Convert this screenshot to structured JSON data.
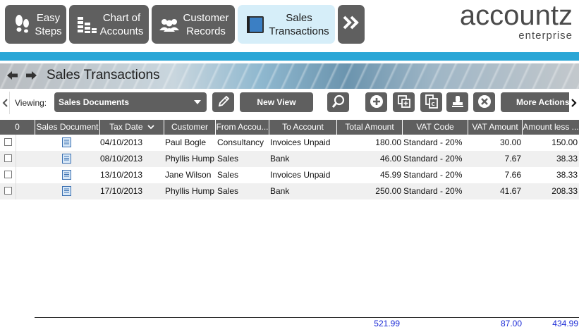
{
  "nav": {
    "items": [
      {
        "label_line1": "Easy",
        "label_line2": "Steps",
        "icon": "footprints-icon"
      },
      {
        "label_line1": "Chart of",
        "label_line2": "Accounts",
        "icon": "coins-chart-icon"
      },
      {
        "label_line1": "Customer",
        "label_line2": "Records",
        "icon": "people-icon"
      },
      {
        "label_line1": "Sales",
        "label_line2": "Transactions",
        "icon": "ledger-book-icon",
        "active": true
      }
    ],
    "more_icon": "double-chevron-right-icon"
  },
  "logo": {
    "brand": "accountz",
    "edition": "enterprise"
  },
  "page": {
    "title": "Sales Transactions"
  },
  "toolbar": {
    "viewing_label": "Viewing:",
    "view_selected": "Sales Documents",
    "new_view_label": "New View",
    "more_actions_label": "More Actions"
  },
  "table": {
    "columns": [
      "0",
      "Sales Document",
      "Tax Date",
      "Customer",
      "From Accou...",
      "To Account",
      "Total Amount",
      "VAT Code",
      "VAT Amount",
      "Amount less ..."
    ],
    "sort_indicator": "chevron-down-icon",
    "rows": [
      {
        "tax_date": "04/10/2013",
        "customer": "Paul Bogle",
        "from": "Consultancy",
        "to": "Invoices Unpaid",
        "total": "180.00",
        "vat_code": "Standard - 20%",
        "vat_amount": "30.00",
        "less": "150.00"
      },
      {
        "tax_date": "08/10/2013",
        "customer": "Phyllis Hump",
        "from": "Sales",
        "to": "Bank",
        "total": "46.00",
        "vat_code": "Standard - 20%",
        "vat_amount": "7.67",
        "less": "38.33"
      },
      {
        "tax_date": "13/10/2013",
        "customer": "Jane Wilson",
        "from": "Sales",
        "to": "Invoices Unpaid",
        "total": "45.99",
        "vat_code": "Standard - 20%",
        "vat_amount": "7.66",
        "less": "38.33"
      },
      {
        "tax_date": "17/10/2013",
        "customer": "Phyllis Hump",
        "from": "Sales",
        "to": "Bank",
        "total": "250.00",
        "vat_code": "Standard - 20%",
        "vat_amount": "41.67",
        "less": "208.33"
      }
    ],
    "totals": {
      "total": "521.99",
      "vat_amount": "87.00",
      "less": "434.99"
    }
  },
  "colors": {
    "button_gray": "#5f5f5f",
    "accent_blue": "#2aa6d6",
    "active_tab": "#d6eef9",
    "total_text": "#1b2ad6"
  }
}
